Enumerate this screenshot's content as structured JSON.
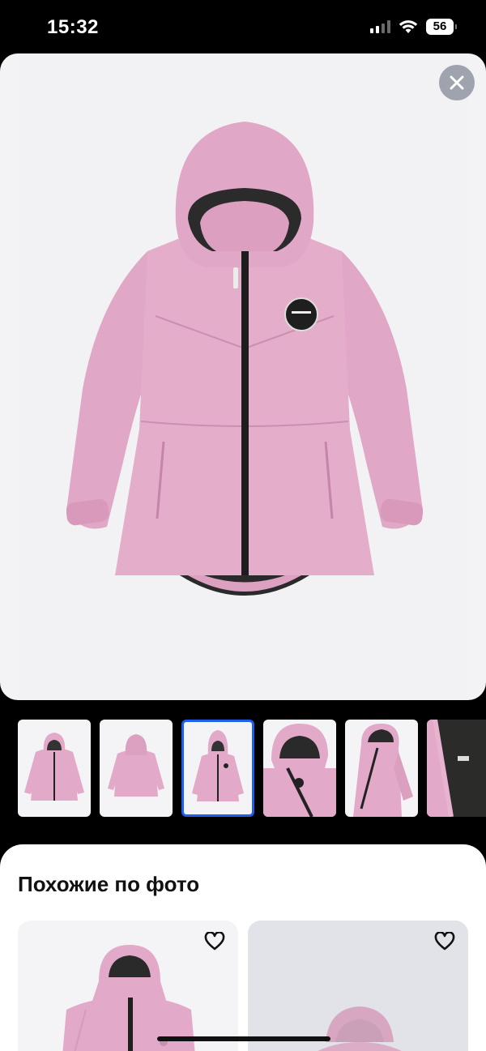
{
  "status_bar": {
    "time": "15:32",
    "battery_level": "56",
    "signal_bars_active": 2,
    "signal_bars_total": 4
  },
  "gallery": {
    "close_icon": "close-icon",
    "thumbnail_count_visible": 6,
    "selected_thumbnail_index": 2,
    "accent_color": "#1e5ff0",
    "jacket_color": "#e0a7c6"
  },
  "similar": {
    "title": "Похожие по фото",
    "favorite_icon": "heart-icon"
  }
}
